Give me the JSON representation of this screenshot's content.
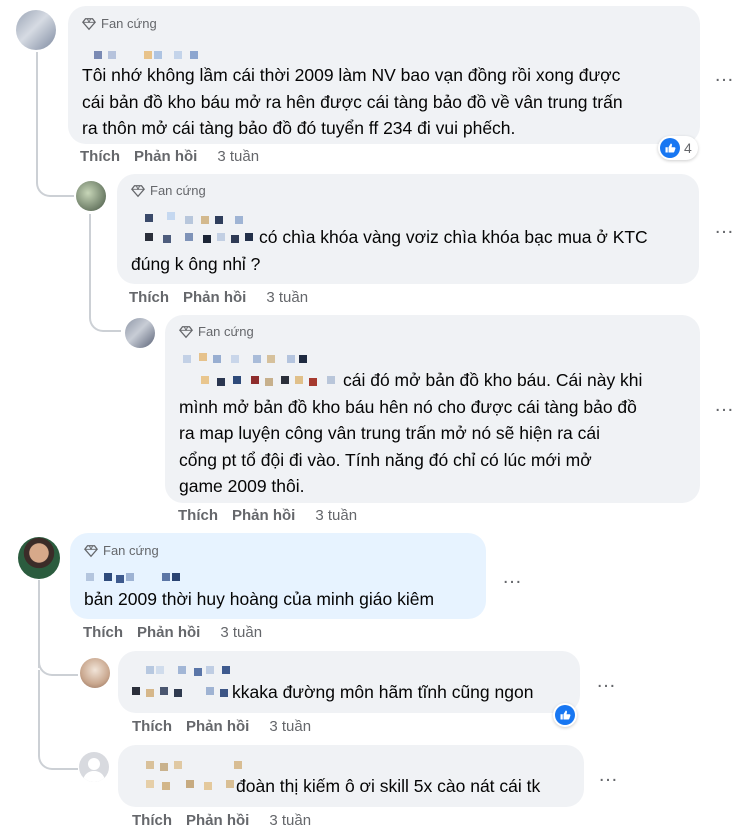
{
  "comments": [
    {
      "badge": "Fan cứng",
      "text_lines": [
        "Tôi nhớ không lầm cái thời 2009 làm NV bao vạn đồng rồi xong được",
        "cái bản đồ kho báu mở ra hên được cái tàng bảo đồ về vân trung trấn",
        "ra thôn mở cái tàng bảo đồ đó tuyển ff 234 đi vui phếch."
      ],
      "like": "Thích",
      "reply": "Phản hồi",
      "time": "3 tuần",
      "reactions": "4"
    },
    {
      "badge": "Fan cứng",
      "text_lines": [
        "có chìa khóa vàng vơiz chìa khóa bạc mua ở KTC",
        "đúng k ông nhỉ ?"
      ],
      "like": "Thích",
      "reply": "Phản hồi",
      "time": "3 tuần"
    },
    {
      "badge": "Fan cứng",
      "text_lines": [
        "cái đó mở bản đồ kho báu. Cái này khi",
        "mình mở bản đồ kho báu hên nó cho được cái tàng bảo đồ",
        "ra map luyện công vân trung trấn mở nó sẽ hiện ra cái",
        "cổng pt tổ đội đi vào. Tính năng đó chỉ có lúc mới mở",
        "game 2009 thôi."
      ],
      "like": "Thích",
      "reply": "Phản hồi",
      "time": "3 tuần"
    },
    {
      "badge": "Fan cứng",
      "text_lines": [
        "bản 2009 thời huy hoàng của minh giáo kiêm"
      ],
      "like": "Thích",
      "reply": "Phản hồi",
      "time": "3 tuần"
    },
    {
      "text_lines": [
        "kkaka đường môn hãm tĩnh cũng ngon"
      ],
      "like": "Thích",
      "reply": "Phản hồi",
      "time": "3 tuần"
    },
    {
      "text_lines": [
        "đoàn thị kiếm ô ơi skill 5x cào nát cái tk"
      ],
      "like": "Thích",
      "reply": "Phản hồi",
      "time": "3 tuần"
    }
  ],
  "more_icon": "…",
  "colors": {
    "bubble": "#f0f2f5",
    "bubble_highlight": "#e7f3ff",
    "like_blue": "#1877f2",
    "meta_gray": "#65676b"
  }
}
